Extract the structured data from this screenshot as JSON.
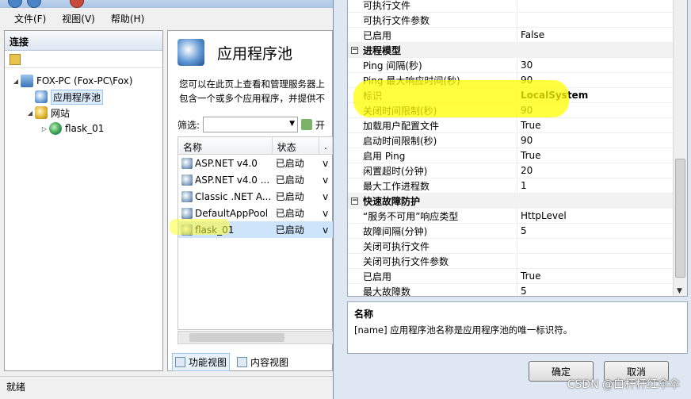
{
  "menu": [
    "文件(F)",
    "视图(V)",
    "帮助(H)"
  ],
  "left_pane": {
    "header": "连接",
    "tree": [
      {
        "label": "FOX-PC (Fox-PC\\Fox)",
        "indent": 0,
        "arrow": "◢",
        "icon": "computer-icon"
      },
      {
        "label": "应用程序池",
        "indent": 1,
        "arrow": "",
        "icon": "app-pool-icon",
        "selected": true
      },
      {
        "label": "网站",
        "indent": 1,
        "arrow": "◢",
        "icon": "sites-folder-icon"
      },
      {
        "label": "flask_01",
        "indent": 2,
        "arrow": "▷",
        "icon": "globe-icon"
      }
    ]
  },
  "main": {
    "title": "应用程序池",
    "description": [
      "您可以在此页上查看和管理服务器上",
      "包含一个或多个应用程序，并提供不"
    ],
    "filter_label": "筛选:",
    "filter_go": "开",
    "columns": [
      "名称",
      "状态",
      "."
    ],
    "rows": [
      {
        "name": "ASP.NET v4.0",
        "status": "已启动",
        "v": "v"
      },
      {
        "name": "ASP.NET v4.0 ...",
        "status": "已启动",
        "v": "v"
      },
      {
        "name": "Classic .NET A...",
        "status": "已启动",
        "v": "v"
      },
      {
        "name": "DefaultAppPool",
        "status": "已启动",
        "v": "v"
      },
      {
        "name": "flask_01",
        "status": "已启动",
        "v": "v",
        "selected": true
      }
    ],
    "view_tabs": [
      "功能视图",
      "内容视图"
    ]
  },
  "status_bar": "就绪",
  "properties": [
    {
      "name": "可执行文件",
      "value": ""
    },
    {
      "name": "可执行文件参数",
      "value": ""
    },
    {
      "name": "已启用",
      "value": "False"
    },
    {
      "category": "进程模型"
    },
    {
      "name": "Ping 间隔(秒)",
      "value": "30"
    },
    {
      "name": "Ping 最大响应时间(秒)",
      "value": "90"
    },
    {
      "name": "标识",
      "value": "LocalSystem",
      "bold": true
    },
    {
      "name": "关闭时间限制(秒)",
      "value": "90"
    },
    {
      "name": "加载用户配置文件",
      "value": "True"
    },
    {
      "name": "启动时间限制(秒)",
      "value": "90"
    },
    {
      "name": "启用 Ping",
      "value": "True"
    },
    {
      "name": "闲置超时(分钟)",
      "value": "20"
    },
    {
      "name": "最大工作进程数",
      "value": "1"
    },
    {
      "category": "快速故障防护"
    },
    {
      "name": "“服务不可用”响应类型",
      "value": "HttpLevel"
    },
    {
      "name": "故障间隔(分钟)",
      "value": "5"
    },
    {
      "name": "关闭可执行文件",
      "value": ""
    },
    {
      "name": "关闭可执行文件参数",
      "value": ""
    },
    {
      "name": "已启用",
      "value": "True"
    },
    {
      "name": "最大故障数",
      "value": "5"
    }
  ],
  "description_box": {
    "title": "名称",
    "text": "[name] 应用程序池名称是应用程序池的唯一标识符。"
  },
  "buttons": {
    "ok": "确定",
    "cancel": "取消"
  },
  "watermark": "CSDN @白杆杆红伞伞",
  "colors": {
    "highlight": "#ffff00",
    "selection": "#cde4fa"
  }
}
